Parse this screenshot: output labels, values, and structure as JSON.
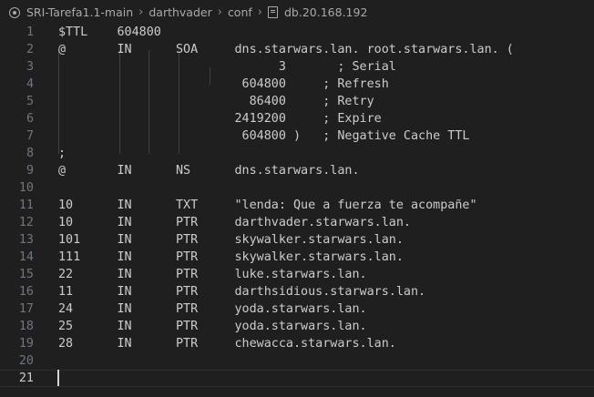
{
  "breadcrumb": {
    "repo": "SRI-Tarefa1.1-main",
    "folder1": "darthvader",
    "folder2": "conf",
    "file": "db.20.168.192",
    "repo_icon": "repo-icon",
    "file_icon": "file-icon",
    "separator_icon": "chevron-right-icon"
  },
  "editor": {
    "lines": [
      {
        "n": "1",
        "text": "$TTL    604800"
      },
      {
        "n": "2",
        "text": "@       IN      SOA     dns.starwars.lan. root.starwars.lan. ("
      },
      {
        "n": "3",
        "text": "                              3       ; Serial"
      },
      {
        "n": "4",
        "text": "                         604800     ; Refresh"
      },
      {
        "n": "5",
        "text": "                          86400     ; Retry"
      },
      {
        "n": "6",
        "text": "                        2419200     ; Expire"
      },
      {
        "n": "7",
        "text": "                         604800 )   ; Negative Cache TTL"
      },
      {
        "n": "8",
        "text": ";"
      },
      {
        "n": "9",
        "text": "@       IN      NS      dns.starwars.lan."
      },
      {
        "n": "10",
        "text": ""
      },
      {
        "n": "11",
        "text": "10      IN      TXT     \"lenda: Que a fuerza te acompañe\""
      },
      {
        "n": "12",
        "text": "10      IN      PTR     darthvader.starwars.lan."
      },
      {
        "n": "13",
        "text": "101     IN      PTR     skywalker.starwars.lan."
      },
      {
        "n": "14",
        "text": "111     IN      PTR     skywalker.starwars.lan."
      },
      {
        "n": "15",
        "text": "22      IN      PTR     luke.starwars.lan."
      },
      {
        "n": "16",
        "text": "11      IN      PTR     darthsidious.starwars.lan."
      },
      {
        "n": "17",
        "text": "24      IN      PTR     yoda.starwars.lan."
      },
      {
        "n": "18",
        "text": "25      IN      PTR     yoda.starwars.lan."
      },
      {
        "n": "19",
        "text": "28      IN      PTR     chewacca.starwars.lan."
      },
      {
        "n": "20",
        "text": ""
      },
      {
        "n": "21",
        "text": ""
      }
    ]
  },
  "colors": {
    "background": "#1f1f1f",
    "text": "#cccccc",
    "line_number": "#6e7681",
    "indent_guide": "#404040"
  }
}
